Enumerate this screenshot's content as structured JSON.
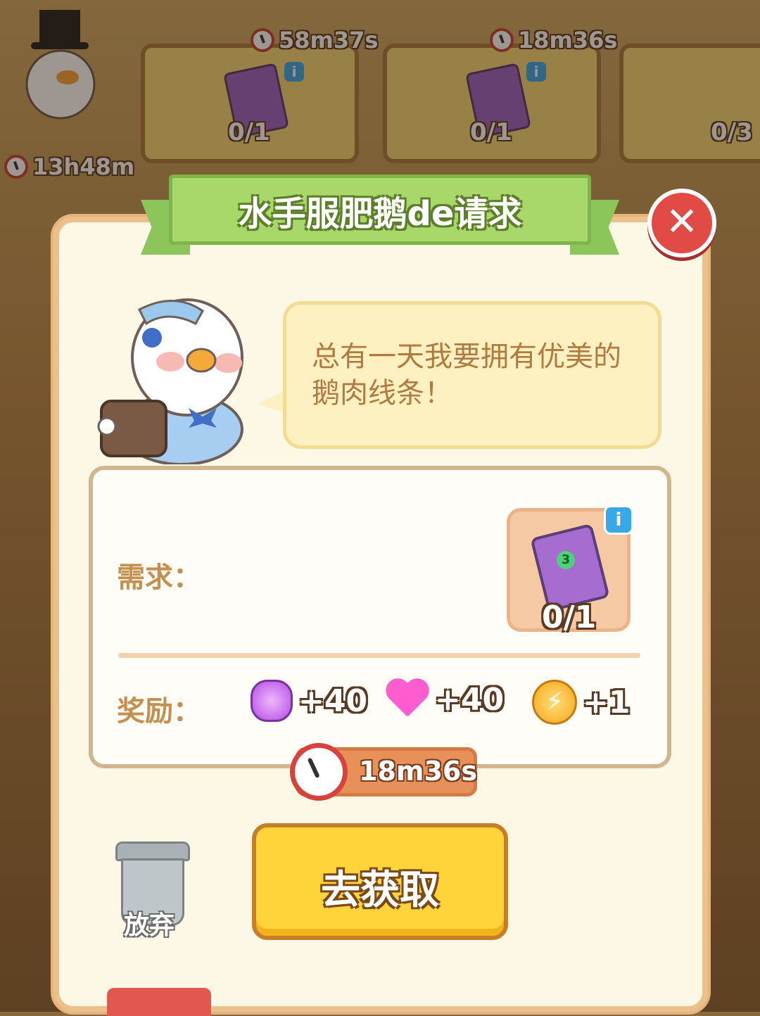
{
  "top_orders": [
    {
      "timer": "58m37s",
      "count": "0/1"
    },
    {
      "timer": "18m36s",
      "count": "0/1"
    },
    {
      "count": "0/3"
    }
  ],
  "left_timer": "13h48m",
  "dialog": {
    "title": "水手服肥鹅de请求",
    "speech": "总有一天我要拥有优美的鹅肉线条！",
    "need_label": "需求：",
    "need_item_count": "0/1",
    "reward_label": "奖励：",
    "rewards": [
      {
        "icon": "gem-icon",
        "value": "+40"
      },
      {
        "icon": "heart-icon",
        "value": "+40"
      },
      {
        "icon": "energy-icon",
        "value": "+1"
      }
    ],
    "timer": "18m36s",
    "abandon_label": "放弃",
    "go_label": "去获取"
  },
  "colors": {
    "panel": "#fdf7e6",
    "ribbon": "#a9d86a",
    "button": "#ffd33a",
    "close": "#e24a46"
  }
}
